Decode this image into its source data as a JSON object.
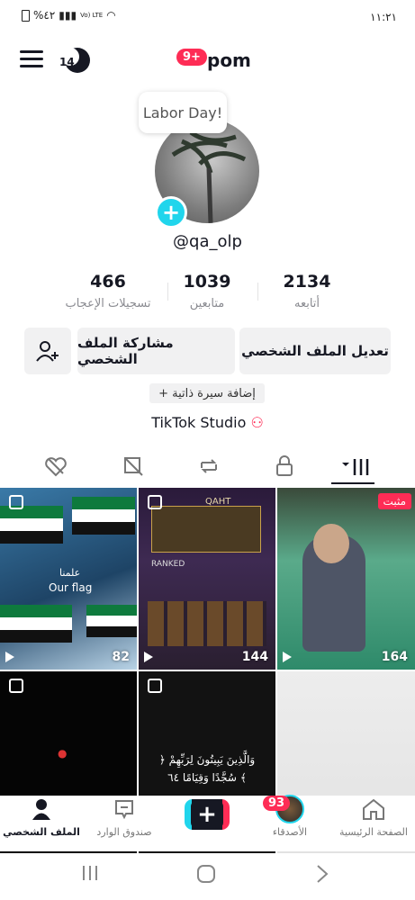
{
  "status": {
    "time": "١١:٢١",
    "battery": "%٤٢",
    "network": "Vo) LTE"
  },
  "header": {
    "badge": "9+",
    "username": "pom",
    "moon_count": "14"
  },
  "profile": {
    "bubble": "Labor Day!",
    "handle": "@qa_olp",
    "stats": [
      {
        "value": "466",
        "label": "تسجيلات الإعجاب"
      },
      {
        "value": "1039",
        "label": "متابعين"
      },
      {
        "value": "2134",
        "label": "أتابعه"
      }
    ],
    "buttons": {
      "edit": "تعديل الملف الشخصي",
      "share": "مشاركة الملف الشخصي"
    },
    "add_bio": "+ إضافة سيرة ذاتية",
    "studio": "TikTok Studio"
  },
  "grid": [
    {
      "count": "82",
      "caption": "Our flag",
      "overlay": "علمنا"
    },
    {
      "count": "144",
      "game_tag": "QAHT",
      "rank": "RANKED"
    },
    {
      "count": "164",
      "pinned": "مثبت"
    },
    {
      "count": ""
    },
    {
      "count": "",
      "text": "﴿ وَالَّذِينَ يَبِيتُونَ لِرَبِّهِمْ سُجَّدًا وَقِيَامًا ٦٤ ﴾"
    },
    {
      "count": ""
    }
  ],
  "nav": {
    "home": "الصفحة الرئيسية",
    "friends": "الأصدقاء",
    "friends_badge": "93",
    "inbox": "صندوق الوارد",
    "profile": "الملف الشخصي"
  },
  "colors": {
    "accent": "#fe2c55",
    "cyan": "#20d5ec",
    "text": "#161823"
  }
}
